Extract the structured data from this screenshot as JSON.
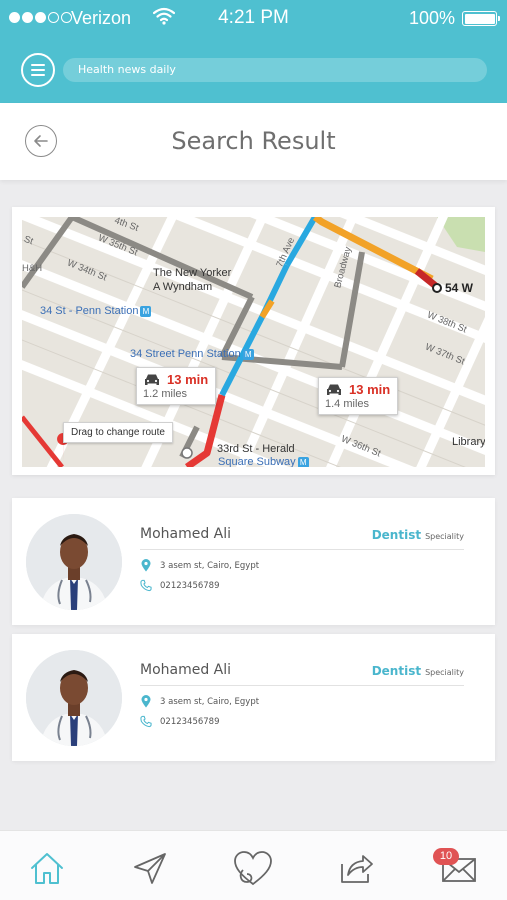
{
  "status_bar": {
    "carrier": "Verizon",
    "time": "4:21 PM",
    "battery": "100%"
  },
  "app_bar": {
    "news_text": "Health news daily"
  },
  "header": {
    "title": "Search Result"
  },
  "map": {
    "labels": {
      "w35": "W 35th St",
      "w34": "W 34th St",
      "newyorker1": "The New Yorker",
      "newyorker2": "A Wyndham",
      "penn34": "34 St - Penn Station",
      "penn_street": "34 Street Penn Station",
      "herald1": "33rd St - Herald",
      "herald2": "Square Subway",
      "w38": "W 38th St",
      "w37": "W 37th St",
      "seventh": "7th Ave",
      "broadway": "Broadway",
      "w36": "W 36th St",
      "library": "Library",
      "fourth_st": "4th St",
      "st_left": "St",
      "hm": "H&H"
    },
    "route_a": {
      "time": "13 min",
      "distance": "1.2 miles"
    },
    "route_b": {
      "time": "13 min",
      "distance": "1.4 miles"
    },
    "drag_tip": "Drag to change route",
    "destination": "54 W",
    "subway_icon": "M",
    "route_colors": {
      "red": "#e53935",
      "blue": "#29a8e0",
      "orange": "#f2a227",
      "gray": "#8c8a85"
    }
  },
  "doctors": [
    {
      "name": "Mohamed Ali",
      "specialty": "Dentist",
      "specialty_label": "Speciality",
      "address": "3 asem st, Cairo, Egypt",
      "phone": "02123456789"
    },
    {
      "name": "Mohamed Ali",
      "specialty": "Dentist",
      "specialty_label": "Speciality",
      "address": "3 asem st, Cairo, Egypt",
      "phone": "02123456789"
    }
  ],
  "bottom_nav": {
    "items": [
      "home-icon",
      "send-icon",
      "favorites-icon",
      "share-icon",
      "messages-icon"
    ],
    "badge": "10"
  },
  "colors": {
    "accent": "#4fc0d0",
    "specialty": "#4ab6cd",
    "badge": "#e05354"
  }
}
